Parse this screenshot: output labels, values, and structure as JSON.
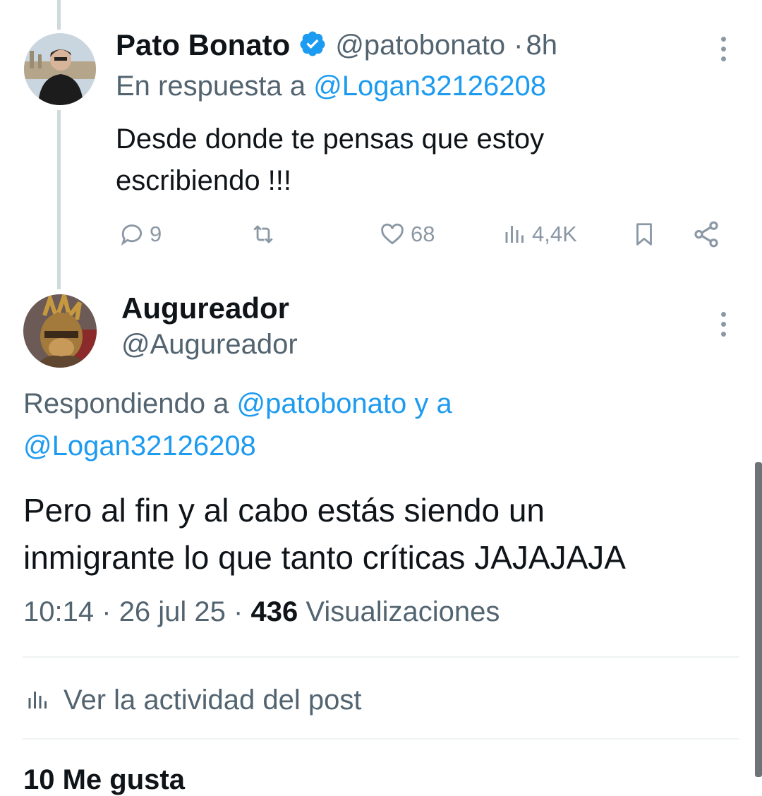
{
  "tweet1": {
    "display_name": "Pato Bonato",
    "verified": true,
    "handle": "@patobonato",
    "separator": "·",
    "time": "8h",
    "reply_prefix": "En respuesta a",
    "reply_to": "@Logan32126208",
    "text_line1": "Desde donde te pensas que estoy",
    "text_line2": "escribiendo !!!",
    "actions": {
      "replies": "9",
      "retweets": "",
      "likes": "68",
      "views": "4,4K"
    }
  },
  "tweet2": {
    "display_name": "Augureador",
    "handle": "@Augureador",
    "reply_prefix": "Respondiendo a",
    "reply_to_1": "@patobonato",
    "reply_conj": "y a",
    "reply_to_2": "@Logan32126208",
    "text_line1": "Pero al fin y al cabo estás siendo un",
    "text_line2": "inmigrante lo que tanto críticas JAJAJAJA",
    "time": "10:14",
    "sep1": "·",
    "date": "26 jul 25",
    "sep2": "·",
    "views_count": "436",
    "views_label": "Visualizaciones"
  },
  "activity_label": "Ver la actividad del post",
  "next_stat_partial": "10 Me gusta",
  "colors": {
    "link": "#1d9bf0",
    "muted": "#536471",
    "icon": "#8b98a5",
    "verified": "#1d9bf0"
  }
}
